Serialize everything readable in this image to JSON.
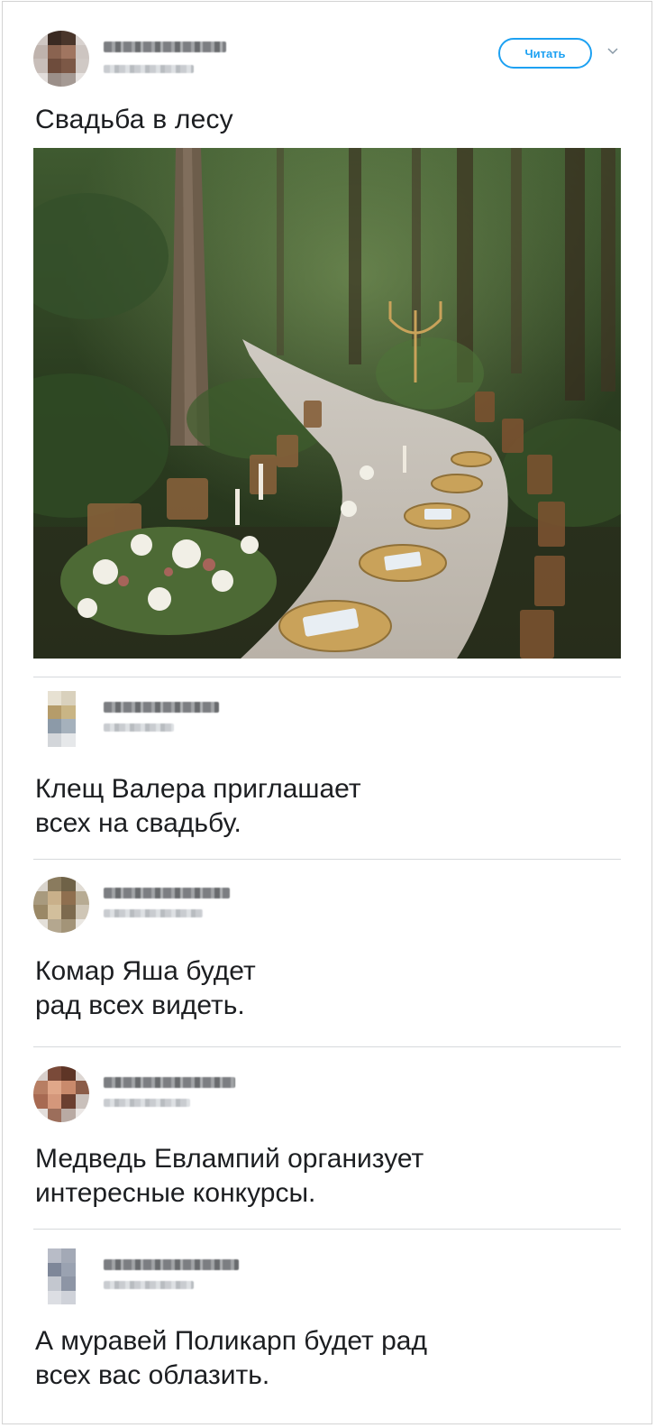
{
  "tweet": {
    "follow_label": "Читать",
    "text": "Свадьба в лесу"
  },
  "replies": [
    {
      "text": "Клещ Валера приглашает\nвсех на свадьбу."
    },
    {
      "text": "Комар Яша будет\nрад всех видеть."
    },
    {
      "text": "Медведь Евлампий организует\nинтересные конкурсы."
    },
    {
      "text": "А муравей Поликарп будет рад\nвсех вас облазить."
    }
  ],
  "colors": {
    "accent": "#1da1f2",
    "text": "#1c1e21",
    "divider": "#d6d9dc"
  },
  "icons": [
    "chevron-down-icon"
  ]
}
